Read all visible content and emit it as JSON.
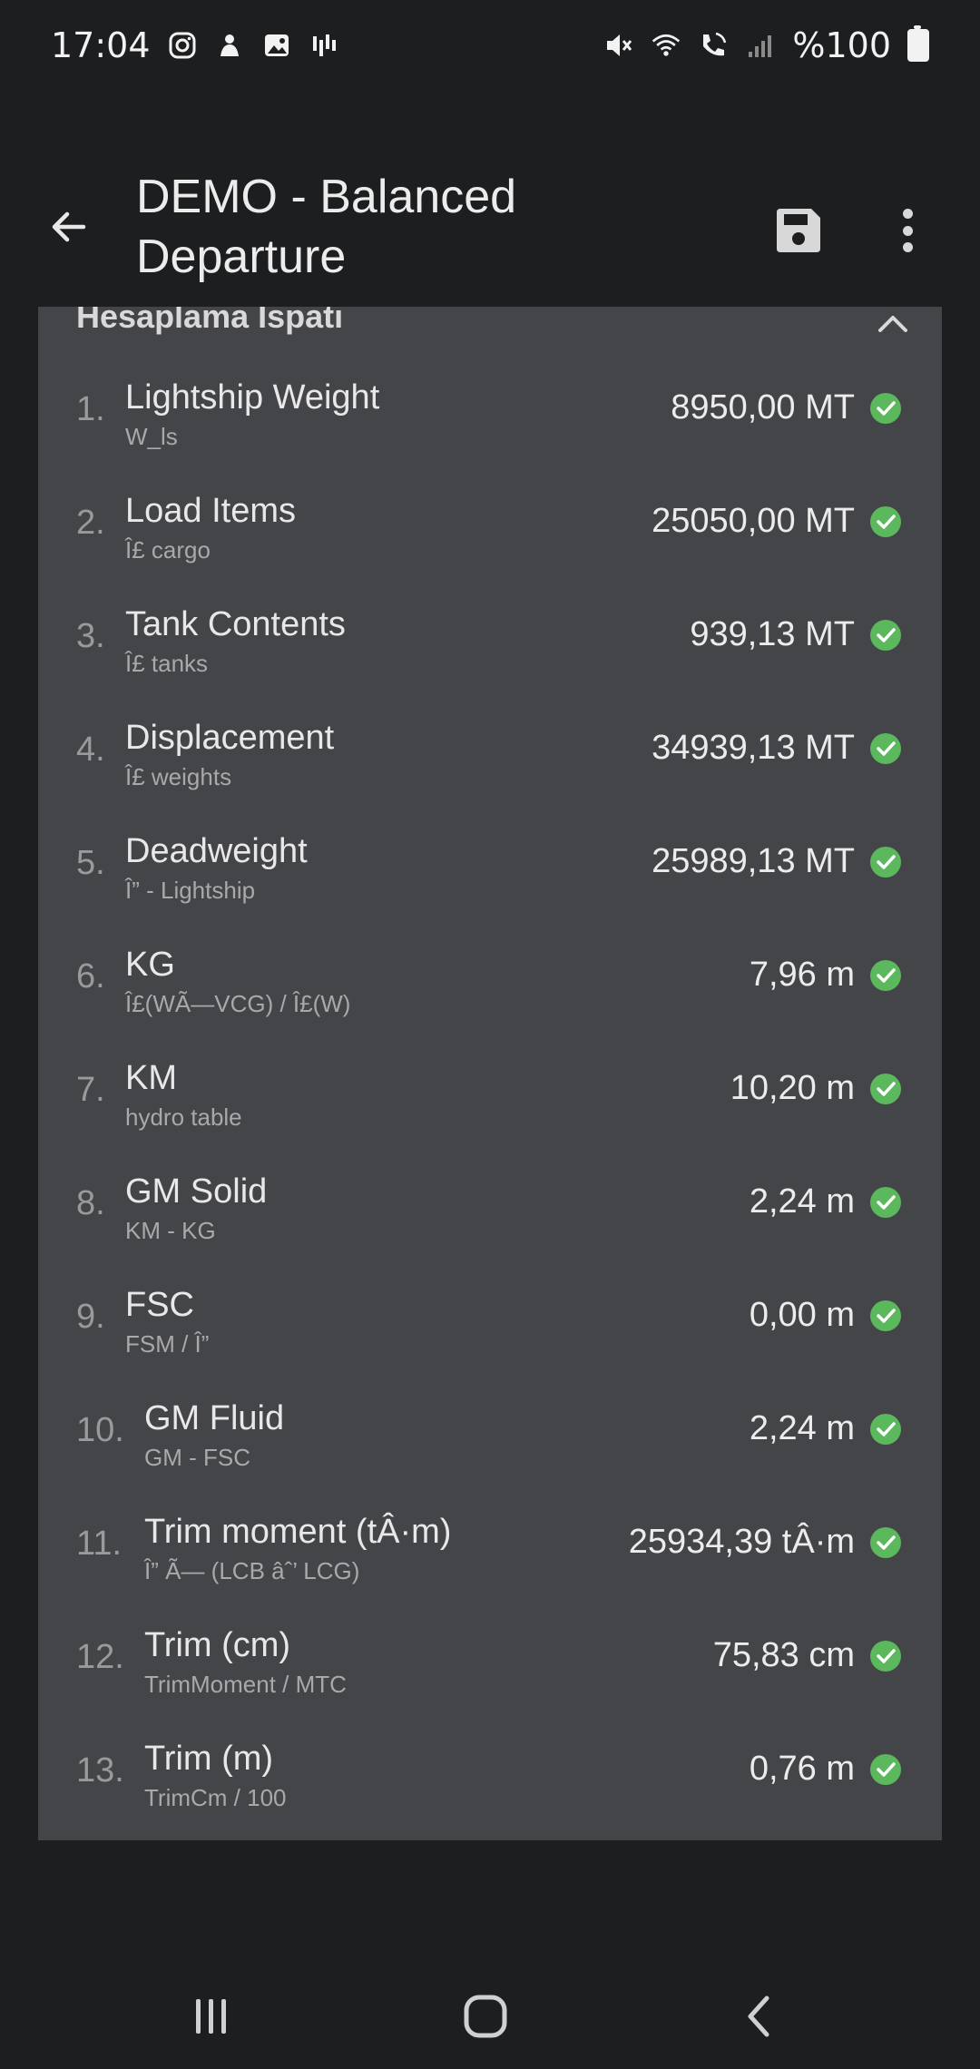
{
  "status_bar": {
    "time": "17:04",
    "left_icons": [
      "instagram-icon",
      "notification-app-icon",
      "gallery-icon",
      "signal-bars-app-icon"
    ],
    "right_icons": [
      "mute-icon",
      "wifi-icon",
      "wifi-calling-icon",
      "cell-signal-icon"
    ],
    "battery_text": "%100"
  },
  "app_bar": {
    "title": "DEMO - Balanced Departure",
    "back_icon": "arrow-left-icon",
    "save_icon": "save-icon",
    "more_icon": "more-vert-icon"
  },
  "card": {
    "title": "Hesaplama İspatı",
    "collapse_icon": "chevron-up-icon",
    "rows": [
      {
        "num": "1.",
        "label": "Lightship Weight",
        "formula": "W_ls",
        "value": "8950,00 MT"
      },
      {
        "num": "2.",
        "label": "Load Items",
        "formula": "Î£ cargo",
        "value": "25050,00 MT"
      },
      {
        "num": "3.",
        "label": "Tank Contents",
        "formula": "Î£ tanks",
        "value": "939,13 MT"
      },
      {
        "num": "4.",
        "label": "Displacement",
        "formula": "Î£ weights",
        "value": "34939,13 MT"
      },
      {
        "num": "5.",
        "label": "Deadweight",
        "formula": "Î” - Lightship",
        "value": "25989,13 MT"
      },
      {
        "num": "6.",
        "label": "KG",
        "formula": "Î£(WÃ—VCG) / Î£(W)",
        "value": "7,96 m"
      },
      {
        "num": "7.",
        "label": "KM",
        "formula": "hydro table",
        "value": "10,20 m"
      },
      {
        "num": "8.",
        "label": "GM Solid",
        "formula": "KM - KG",
        "value": "2,24 m"
      },
      {
        "num": "9.",
        "label": "FSC",
        "formula": "FSM / Î”",
        "value": "0,00 m"
      },
      {
        "num": "10.",
        "label": "GM Fluid",
        "formula": "GM - FSC",
        "value": "2,24 m"
      },
      {
        "num": "11.",
        "label": "Trim moment (tÂ·m)",
        "formula": "Î” Ã— (LCB âˆ’ LCG)",
        "value": "25934,39 tÂ·m"
      },
      {
        "num": "12.",
        "label": "Trim (cm)",
        "formula": "TrimMoment / MTC",
        "value": "75,83 cm"
      },
      {
        "num": "13.",
        "label": "Trim (m)",
        "formula": "TrimCm / 100",
        "value": "0,76 m"
      }
    ],
    "check_icon": "check-circle-icon",
    "check_color": "#5cb85c"
  },
  "nav_bar": {
    "recents_icon": "recents-icon",
    "home_icon": "home-icon",
    "back_icon": "back-icon"
  },
  "colors": {
    "background": "#1d1e20",
    "card": "#444548",
    "accent_check": "#5cb85c"
  }
}
